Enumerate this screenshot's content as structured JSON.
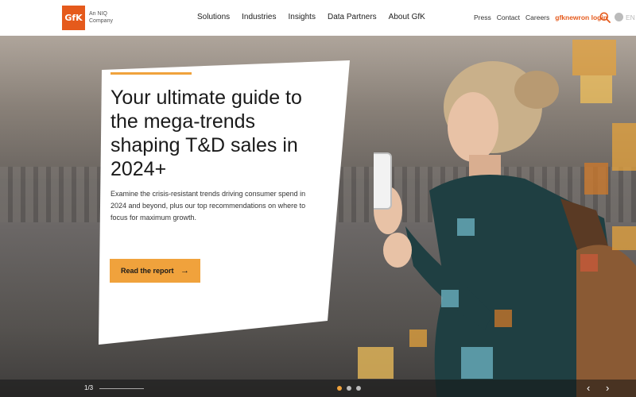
{
  "header": {
    "logo_text": "GfK",
    "logo_sub": "An NIQ Company",
    "main_nav": [
      "Solutions",
      "Industries",
      "Insights",
      "Data Partners",
      "About GfK"
    ],
    "util_nav": {
      "press": "Press",
      "contact": "Contact",
      "careers": "Careers",
      "login": "gfknewron login"
    },
    "language": "EN"
  },
  "hero": {
    "title": "Your ultimate guide to the mega-trends shaping T&D sales in 2024+",
    "body": "Examine the crisis-resistant trends driving consumer spend in 2024 and beyond, plus our top recommendations on where to focus for maximum growth.",
    "cta_label": "Read the report",
    "cta_icon": "arrow-right-icon"
  },
  "slider": {
    "page_indicator": "1/3",
    "dots_count": 3,
    "active_dot": 1
  },
  "colors": {
    "brand_orange": "#e55a1c",
    "accent": "#f0a23c"
  }
}
